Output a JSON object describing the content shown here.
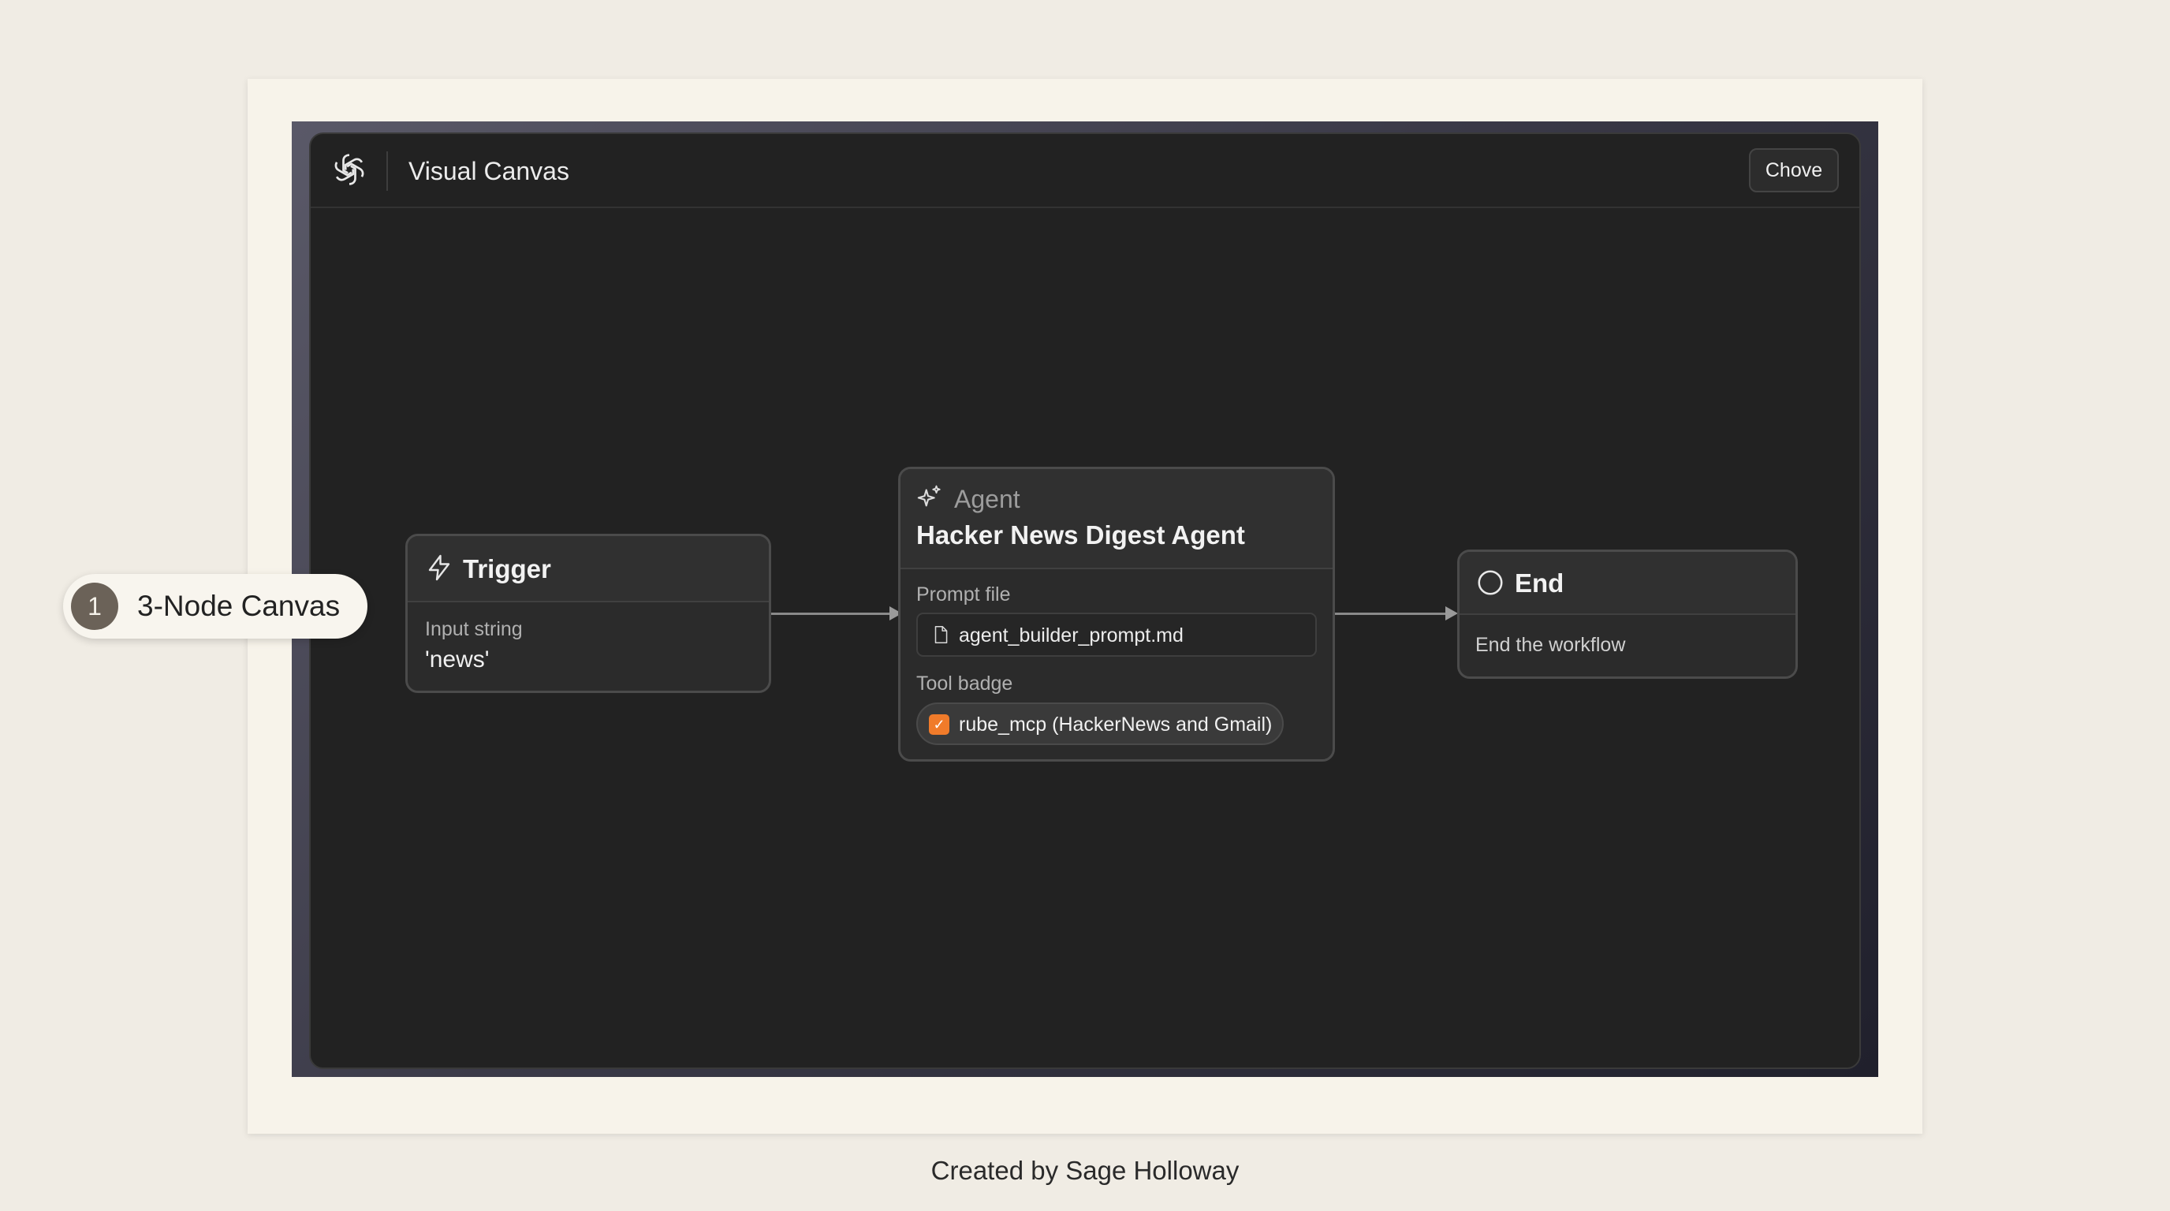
{
  "window": {
    "title": "Visual Canvas",
    "top_button_label": "Chove"
  },
  "nodes": {
    "trigger": {
      "title": "Trigger",
      "field_label": "Input string",
      "field_value": "'news'"
    },
    "agent": {
      "kind": "Agent",
      "title": "Hacker News Digest Agent",
      "prompt_label": "Prompt file",
      "prompt_file": "agent_builder_prompt.md",
      "tool_label": "Tool badge",
      "tool_name": "rube_mcp (HackerNews and Gmail)"
    },
    "end": {
      "title": "End",
      "description": "End the workflow"
    }
  },
  "callout": {
    "number": "1",
    "label": "3-Node Canvas"
  },
  "footer": {
    "credit": "Created by Sage Holloway"
  },
  "colors": {
    "canvas_bg": "#222222",
    "node_bg": "#2b2b2b",
    "tool_badge_accent": "#f07b2a",
    "paper": "#f7f3ea",
    "page_bg": "#f0ece4"
  },
  "icons": {
    "logo": "openai-logo-icon",
    "trigger": "lightning-bolt-icon",
    "agent": "sparkle-icon",
    "end": "circle-icon",
    "prompt_file": "file-icon",
    "tool": "orange-check-badge-icon"
  }
}
